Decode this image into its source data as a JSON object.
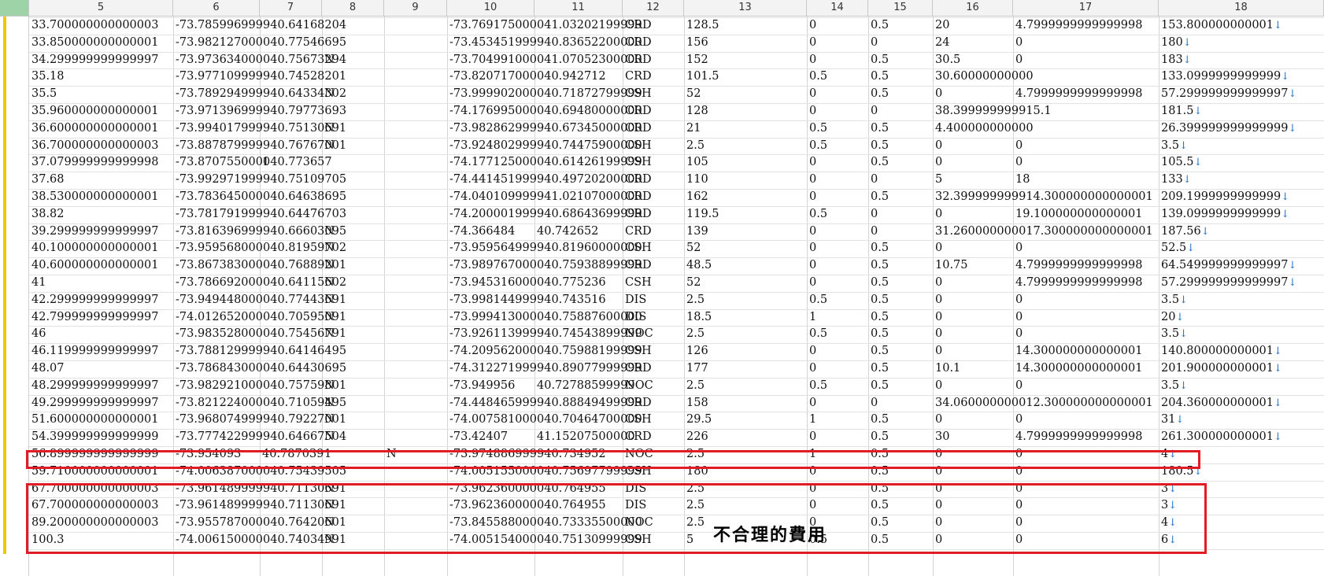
{
  "column_headers": [
    "5",
    "6",
    "7",
    "8",
    "9",
    "10",
    "11",
    "12",
    "13",
    "14",
    "15",
    "16",
    "17",
    "18"
  ],
  "rows": [
    [
      "33.700000000000003",
      "-73.785996999940.64168204",
      "",
      "",
      "",
      "-73.769175000041.03202199999",
      "",
      "CRD",
      "128.5",
      "0",
      "0.5",
      "20",
      "4.7999999999999998",
      "153.800000000001"
    ],
    [
      "33.850000000000001",
      "-73.982127000040.77546695",
      "",
      "",
      "",
      "-73.453451999940.83652200000",
      "",
      "CRD",
      "156",
      "0",
      "0",
      "24",
      "0",
      "180"
    ],
    [
      "34.299999999999997",
      "-73.973634000040.75673294",
      "",
      "N",
      "",
      "-73.704991000041.07052300000",
      "",
      "CRD",
      "152",
      "0",
      "0.5",
      "30.5",
      "0",
      "183"
    ],
    [
      "35.18",
      "-73.977109999940.74528201",
      "",
      "",
      "",
      "-73.820717000040.942712",
      "",
      "CRD",
      "101.5",
      "0.5",
      "0.5",
      "30.60000000000",
      "",
      "133.0999999999999"
    ],
    [
      "35.5",
      "-73.789294999940.64334302",
      "",
      "N",
      "",
      "-73.999902000040.71872799999",
      "",
      "CSH",
      "52",
      "0",
      "0.5",
      "0",
      "4.7999999999999998",
      "57.299999999999997"
    ],
    [
      "35.960000000000001",
      "-73.971396999940.79773693",
      "",
      "",
      "",
      "-74.176995000040.69480000000",
      "",
      "CRD",
      "128",
      "0",
      "0",
      "38.399999999915.1",
      "",
      "181.5"
    ],
    [
      "36.600000000000001",
      "-73.994017999940.75130691",
      "",
      "N",
      "",
      "-73.982862999940.67345000000",
      "",
      "CRD",
      "21",
      "0.5",
      "0.5",
      "4.400000000000",
      "",
      "26.399999999999999"
    ],
    [
      "36.700000000000003",
      "-73.887879999940.76767001",
      "",
      "N",
      "",
      "-73.924802999940.74475900000",
      "",
      "CSH",
      "2.5",
      "0.5",
      "0.5",
      "0",
      "0",
      "3.5"
    ],
    [
      "37.079999999999998",
      "-73.870755000040.773657",
      "1",
      "",
      "",
      "-74.177125000040.61426199999",
      "",
      "CSH",
      "105",
      "0",
      "0.5",
      "0",
      "0",
      "105.5"
    ],
    [
      "37.68",
      "-73.992971999940.75109705",
      "",
      "",
      "",
      "-74.441451999940.49720200000",
      "",
      "CRD",
      "110",
      "0",
      "0",
      "5",
      "18",
      "133"
    ],
    [
      "38.530000000000001",
      "-73.783645000040.64638695",
      "",
      "",
      "",
      "-74.040109999941.02107000000",
      "",
      "CRD",
      "162",
      "0",
      "0.5",
      "32.399999999914.300000000000001",
      "",
      "209.1999999999999"
    ],
    [
      "38.82",
      "-73.781791999940.64476703",
      "",
      "",
      "",
      "-74.200001999940.68643699999",
      "",
      "CRD",
      "119.5",
      "0.5",
      "0",
      "0",
      "19.100000000000001",
      "139.0999999999999"
    ],
    [
      "39.299999999999997",
      "-73.816396999940.66603095",
      "",
      "N",
      "",
      "-74.366484",
      "40.742652",
      "CRD",
      "139",
      "0",
      "0",
      "31.260000000017.300000000000001",
      "",
      "187.56"
    ],
    [
      "40.100000000000001",
      "-73.959568000040.81959702",
      "",
      "N",
      "",
      "-73.959564999940.81960000000",
      "",
      "CSH",
      "52",
      "0",
      "0.5",
      "0",
      "0",
      "52.5"
    ],
    [
      "40.600000000000001",
      "-73.867383000040.76889201",
      "",
      "N",
      "",
      "-73.989767000040.75938899999",
      "",
      "CRD",
      "48.5",
      "0",
      "0.5",
      "10.75",
      "4.7999999999999998",
      "64.549999999999997"
    ],
    [
      "41",
      "-73.786692000040.64115602",
      "",
      "N",
      "",
      "-73.945316000040.775236",
      "",
      "CSH",
      "52",
      "0",
      "0.5",
      "0",
      "4.7999999999999998",
      "57.299999999999997"
    ],
    [
      "42.299999999999997",
      "-73.949448000040.77443691",
      "",
      "N",
      "",
      "-73.998144999940.743516",
      "",
      "DIS",
      "2.5",
      "0.5",
      "0.5",
      "0",
      "0",
      "3.5"
    ],
    [
      "42.799999999999997",
      "-74.012652000040.70595091",
      "",
      "N",
      "",
      "-73.999413000040.75887600000",
      "",
      "DIS",
      "18.5",
      "1",
      "0.5",
      "0",
      "0",
      "20"
    ],
    [
      "46",
      "-73.983528000040.75456791",
      "",
      "N",
      "",
      "-73.926113999940.74543899999",
      "",
      "NOC",
      "2.5",
      "0.5",
      "0.5",
      "0",
      "0",
      "3.5"
    ],
    [
      "46.119999999999997",
      "-73.788129999940.64146495",
      "",
      "",
      "",
      "-74.209562000040.75988199999",
      "",
      "CSH",
      "126",
      "0",
      "0.5",
      "0",
      "14.300000000000001",
      "140.800000000001"
    ],
    [
      "48.07",
      "-73.786843000040.64430695",
      "",
      "",
      "",
      "-74.312271999940.89077999999",
      "",
      "CRD",
      "177",
      "0",
      "0.5",
      "10.1",
      "14.300000000000001",
      "201.900000000001"
    ],
    [
      "48.299999999999997",
      "-73.982921000040.75759801",
      "",
      "N",
      "",
      "-73.949956",
      "40.72788599999",
      "NOC",
      "2.5",
      "0.5",
      "0.5",
      "0",
      "0",
      "3.5"
    ],
    [
      "49.299999999999997",
      "-73.821224000040.71059495",
      "",
      "N",
      "",
      "-74.448465999940.88849499999",
      "",
      "CRD",
      "158",
      "0",
      "0",
      "34.060000000012.300000000000001",
      "",
      "204.360000000001"
    ],
    [
      "51.600000000000001",
      "-73.968074999940.79227001",
      "",
      "N",
      "",
      "-74.007581000040.70464700000",
      "",
      "CSH",
      "29.5",
      "1",
      "0.5",
      "0",
      "0",
      "31"
    ],
    [
      "54.399999999999999",
      "-73.777422999940.64667504",
      "",
      "N",
      "",
      "-73.42407",
      "41.15207500000",
      "CRD",
      "226",
      "0",
      "0.5",
      "30",
      "4.7999999999999998",
      "261.300000000001"
    ],
    [
      "56.899999999999999",
      "-73.954093",
      "40.787039",
      "1",
      "N",
      "-73.974886999940.734952",
      "",
      "NOC",
      "2.5",
      "1",
      "0.5",
      "0",
      "0",
      "4"
    ],
    [
      "59.710000000000001",
      "-74.006387000040.75439505",
      "",
      "",
      "",
      "-74.005155000040.75697799999",
      "",
      "CSH",
      "180",
      "0",
      "0.5",
      "0",
      "0",
      "180.5"
    ],
    [
      "67.700000000000003",
      "-73.961489999940.71130691",
      "",
      "N",
      "",
      "-73.962360000040.764955",
      "",
      "DIS",
      "2.5",
      "0",
      "0.5",
      "0",
      "0",
      "3"
    ],
    [
      "67.700000000000003",
      "-73.961489999940.71130691",
      "",
      "N",
      "",
      "-73.962360000040.764955",
      "",
      "DIS",
      "2.5",
      "0",
      "0.5",
      "0",
      "0",
      "3"
    ],
    [
      "89.200000000000003",
      "-73.955787000040.76420601",
      "",
      "N",
      "",
      "-73.845588000040.73335500000",
      "",
      "NOC",
      "2.5",
      "0",
      "0.5",
      "0",
      "0",
      "4"
    ],
    [
      "100.3",
      "-74.006150000040.74034991",
      "",
      "N",
      "",
      "-74.005154000040.75130999999",
      "",
      "CSH",
      "5",
      "0.5",
      "0.5",
      "0",
      "0",
      "6"
    ]
  ],
  "row_end_marker": "↓",
  "annotation_text": "不合理的費用",
  "colors": {
    "highlight_box": "#e11c24",
    "selection_bar": "#f2c500",
    "corner": "#9ed3a8",
    "end_marker": "#1f70c8"
  }
}
